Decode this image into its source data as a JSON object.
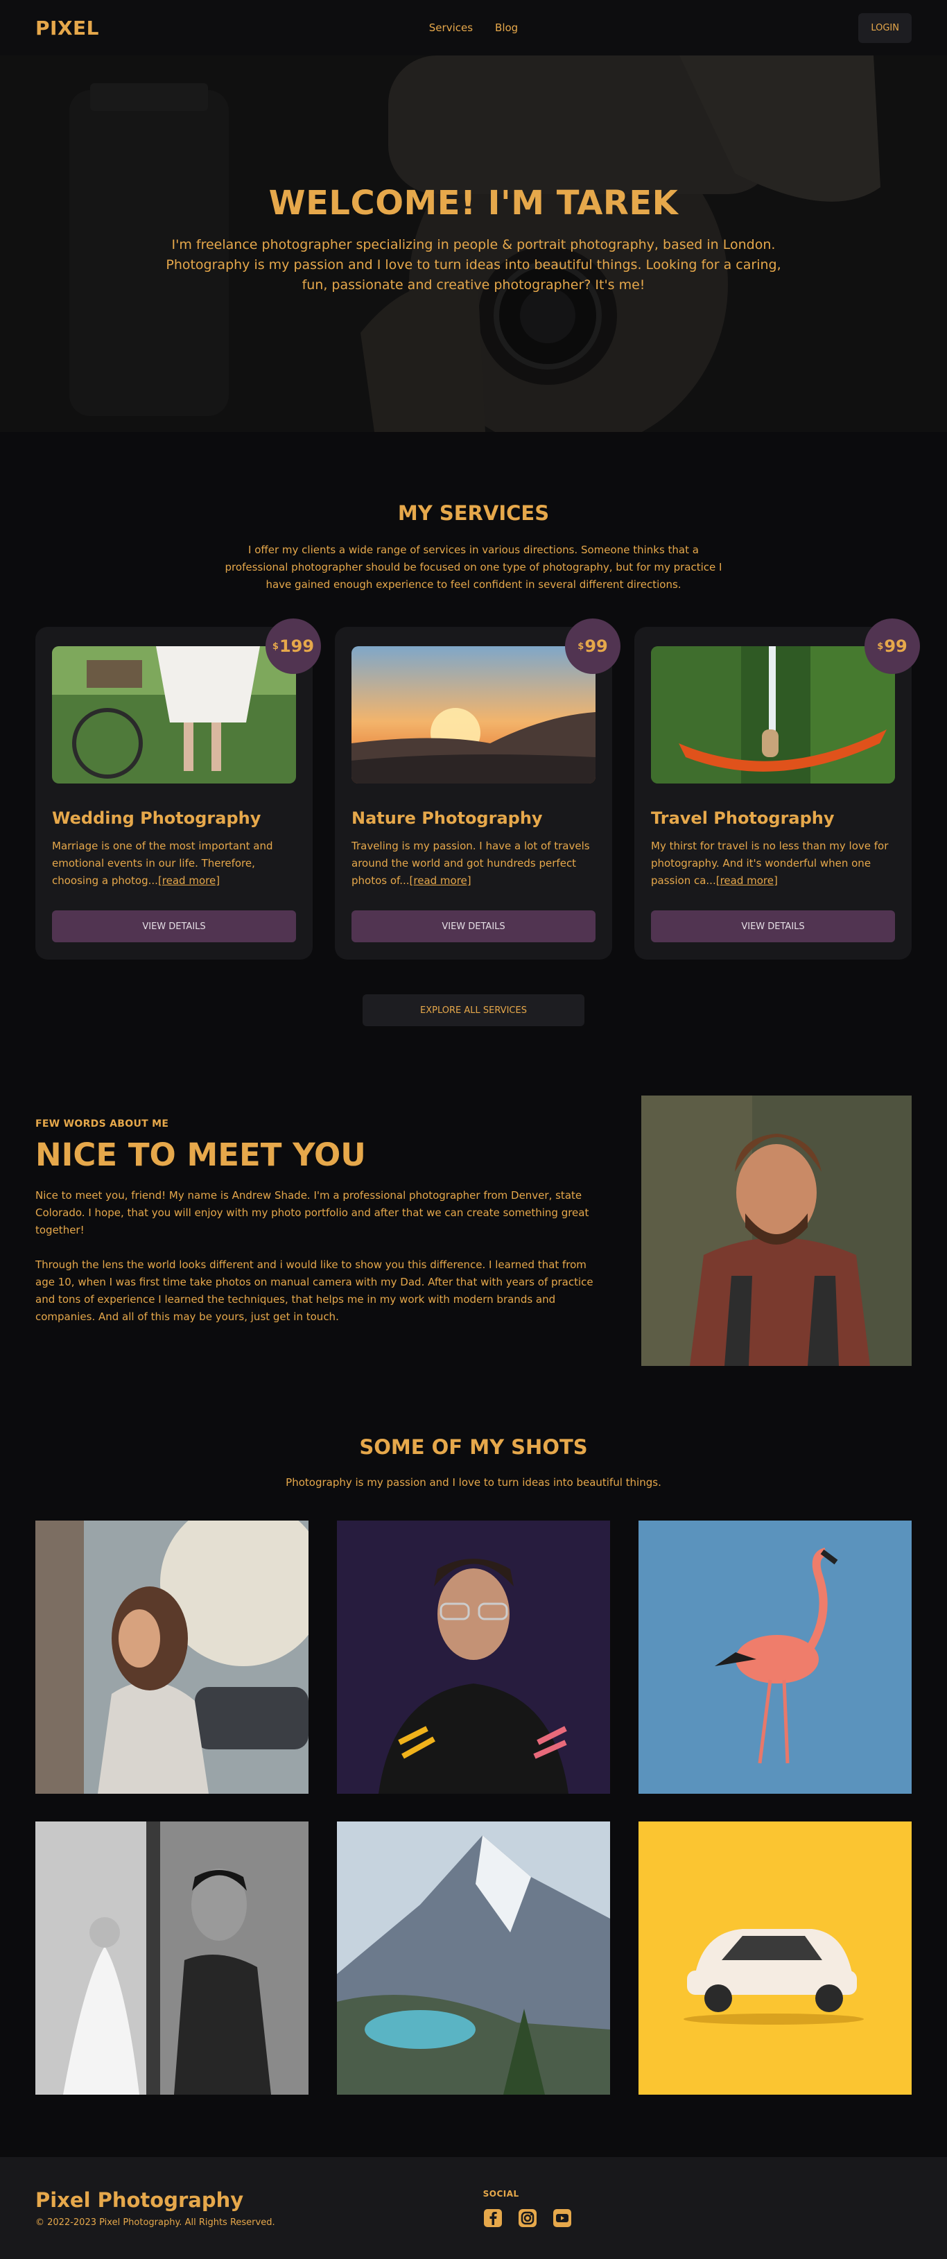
{
  "nav": {
    "logo": "PIXEL",
    "links": [
      "Services",
      "Blog"
    ],
    "login": "LOGIN"
  },
  "hero": {
    "title": "WELCOME! I'M TAREK",
    "text": "I'm freelance photographer specializing in people & portrait photography, based in London. Photography is my passion and I love to turn ideas into beautiful things. Looking for a caring, fun, passionate and creative photographer? It's me!"
  },
  "services": {
    "title": "MY SERVICES",
    "subtitle": "I offer my clients a wide range of services in various directions. Someone thinks that a professional photographer should be focused on one type of photography, but for my practice I have gained enough experience to feel confident in several different directions.",
    "cards": [
      {
        "price_symbol": "$",
        "price": "199",
        "title": "Wedding Photography",
        "text": "Marriage is one of the most important and emotional events in our life. Therefore, choosing a photog...",
        "more": "[read more]",
        "button": "VIEW DETAILS"
      },
      {
        "price_symbol": "$",
        "price": "99",
        "title": "Nature Photography",
        "text": "Traveling is my passion. I have a lot of travels around the world and got hundreds perfect photos of...",
        "more": "[read more]",
        "button": "VIEW DETAILS"
      },
      {
        "price_symbol": "$",
        "price": "99",
        "title": "Travel Photography",
        "text": "My thirst for travel is no less than my love for photography. And it's wonderful when one passion ca...",
        "more": "[read more]",
        "button": "VIEW DETAILS"
      }
    ],
    "explore": "EXPLORE ALL SERVICES"
  },
  "about": {
    "kicker": "FEW WORDS ABOUT ME",
    "title": "NICE TO MEET YOU",
    "p1": "Nice to meet you, friend! My name is Andrew Shade. I'm a professional photographer from Denver, state Colorado. I hope, that you will enjoy with my photo portfolio and after that we can create something great together!",
    "p2": "Through the lens the world looks different and i would like to show you this difference. I learned that from age 10, when I was first time take photos on manual camera with my Dad. After that with years of practice and tons of experience I learned the techniques, that helps me in my work with modern brands and companies. And all of this may be yours, just get in touch."
  },
  "shots": {
    "title": "SOME OF MY SHOTS",
    "subtitle": "Photography is my passion and I love to turn ideas into beautiful things."
  },
  "footer": {
    "brand": "Pixel Photography",
    "copy": "© 2022-2023 Pixel Photography. All Rights Reserved.",
    "social_title": "SOCIAL",
    "icons": [
      "facebook-icon",
      "instagram-icon",
      "youtube-icon"
    ]
  },
  "colors": {
    "accent": "#e6a84b",
    "button": "#513451",
    "background": "#0b0b0d",
    "card": "#18181b"
  }
}
